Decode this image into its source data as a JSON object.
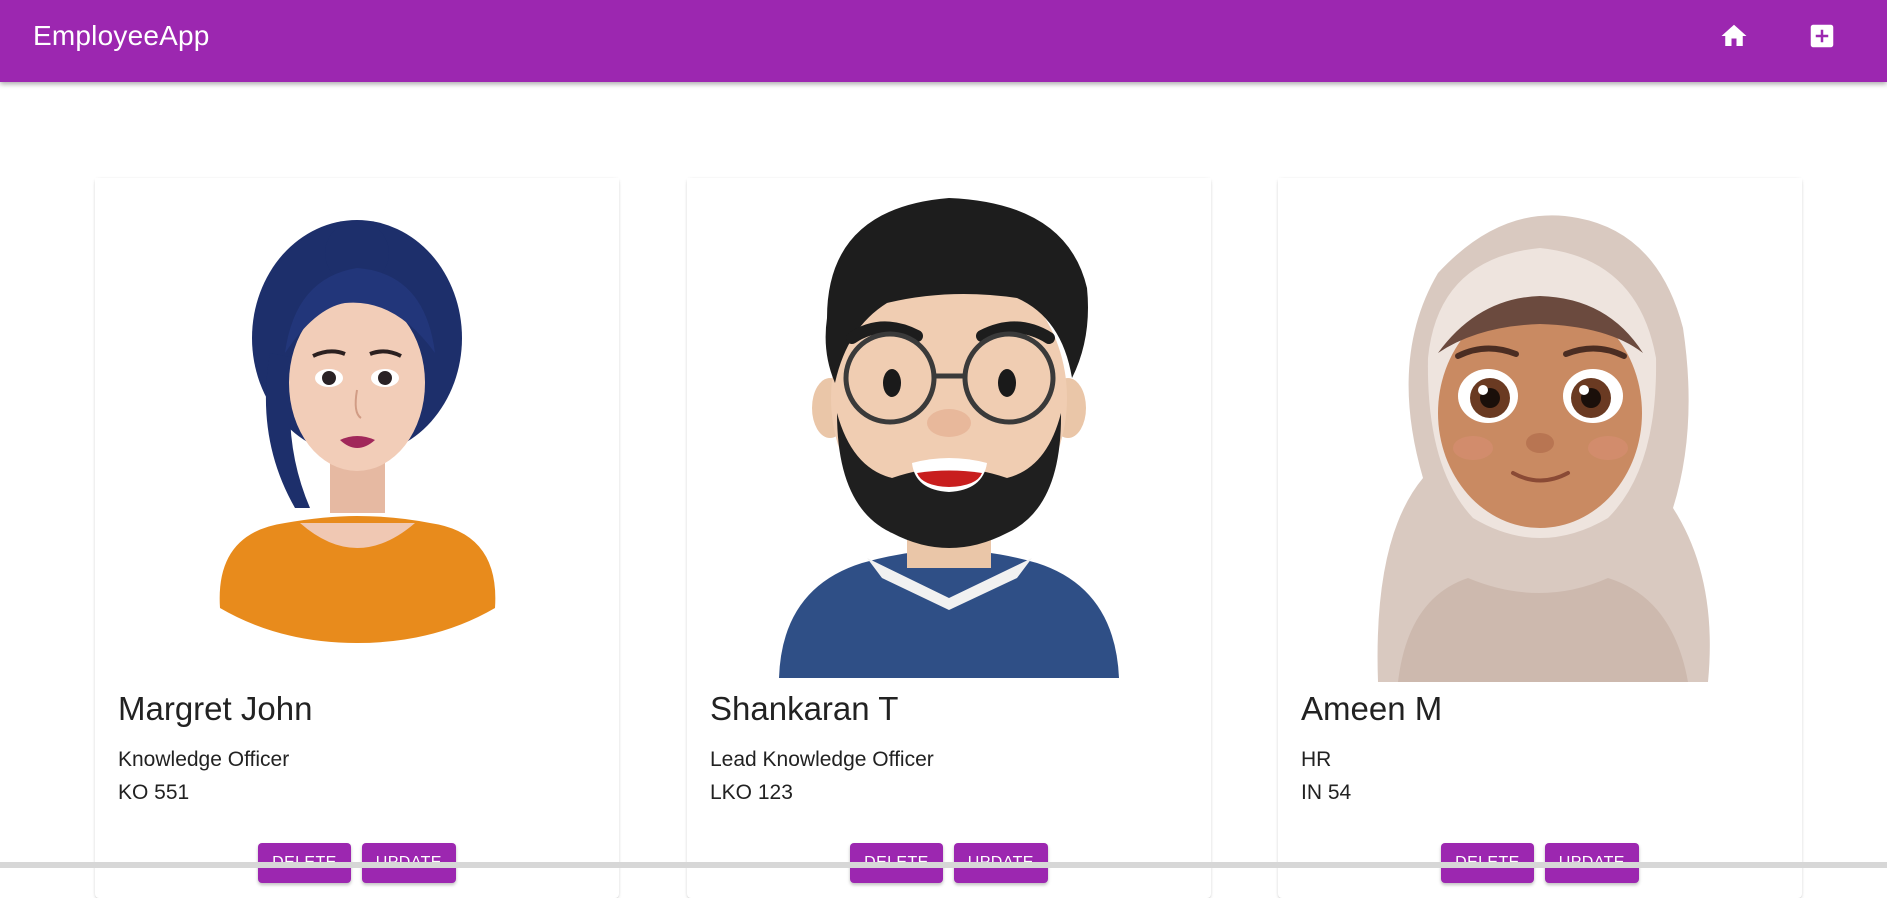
{
  "app": {
    "title": "EmployeeApp",
    "accent_color": "#9c27b0",
    "nav": [
      {
        "icon": "home-icon"
      },
      {
        "icon": "add-box-icon"
      }
    ]
  },
  "employees": [
    {
      "name": "Margret John",
      "role": "Knowledge Officer",
      "code": "KO 551",
      "avatar": "woman-blue-hair-orange-top-avatar",
      "delete_label": "DELETE",
      "update_label": "UPDATE"
    },
    {
      "name": "Shankaran T",
      "role": "Lead Knowledge Officer",
      "code": "LKO 123",
      "avatar": "bearded-man-glasses-avatar",
      "delete_label": "DELETE",
      "update_label": "UPDATE"
    },
    {
      "name": "Ameen M",
      "role": "HR",
      "code": "IN 54",
      "avatar": "girl-hijab-avatar",
      "delete_label": "DELETE",
      "update_label": "UPDATE"
    }
  ]
}
